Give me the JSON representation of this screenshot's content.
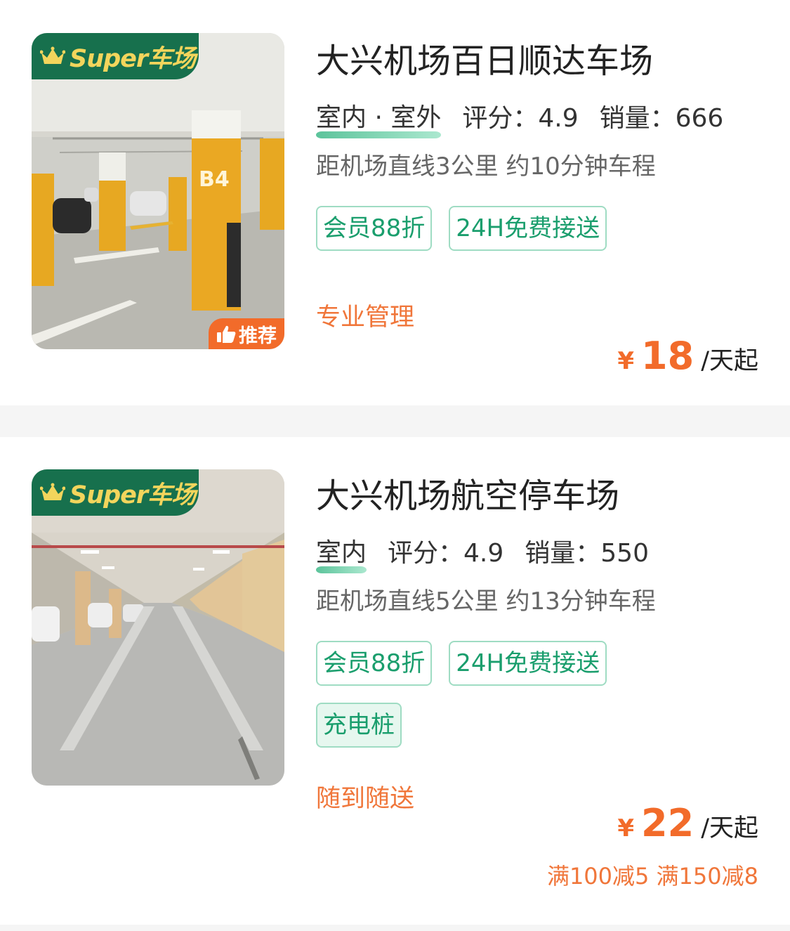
{
  "colors": {
    "brand_green": "#17704d",
    "badge_gold": "#f3d55c",
    "accent_orange": "#f26b2a",
    "tag_green": "#1a9e6d",
    "tag_border": "#9fdcc3"
  },
  "listings": [
    {
      "badge_text": "Super车场",
      "badge_icon": "crown-icon",
      "recommend_text": "推荐",
      "recommend_icon": "thumbs-up-icon",
      "title": "大兴机场百日顺达车场",
      "type": "室内 · 室外",
      "rating_label": "评分：4.9",
      "sales_label": "销量：666",
      "distance": "距机场直线3公里 约10分钟车程",
      "tags": [
        "会员88折",
        "24H免费接送"
      ],
      "slogan": "专业管理",
      "currency": "¥",
      "price": "18",
      "price_unit": "/天起"
    },
    {
      "badge_text": "Super车场",
      "badge_icon": "crown-icon",
      "title": "大兴机场航空停车场",
      "type": "室内",
      "rating_label": "评分：4.9",
      "sales_label": "销量：550",
      "distance": "距机场直线5公里 约13分钟车程",
      "tags": [
        "会员88折",
        "24H免费接送"
      ],
      "extra_tag": "充电桩",
      "slogan": "随到随送",
      "currency": "¥",
      "price": "22",
      "price_unit": "/天起",
      "discount": "满100减5 满150减8"
    }
  ]
}
